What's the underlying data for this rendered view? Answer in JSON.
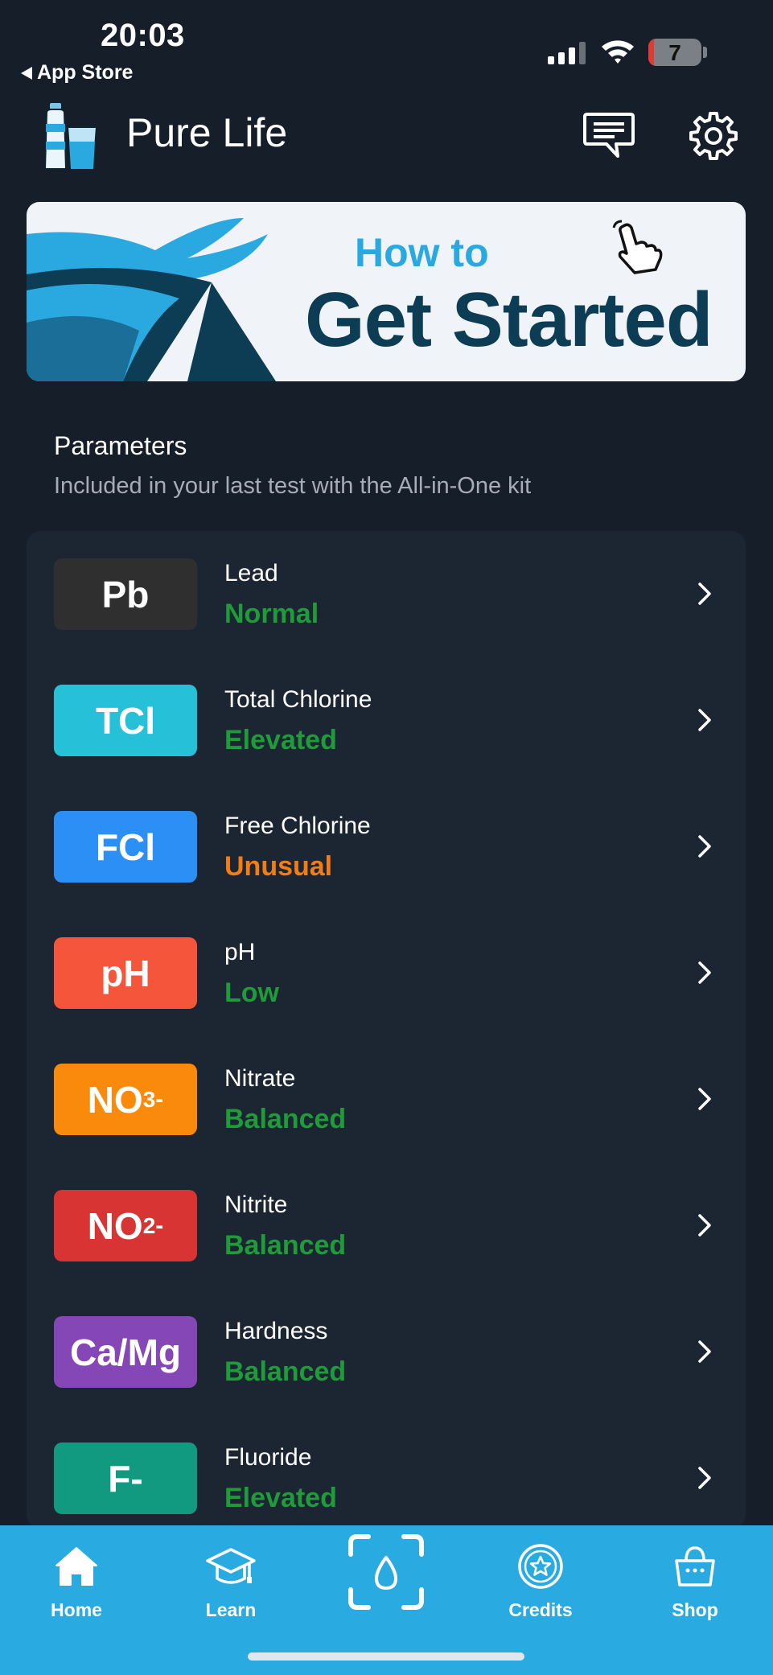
{
  "status_bar": {
    "time": "20:03",
    "back_label": "App Store",
    "battery_level": "7"
  },
  "header": {
    "title": "Pure Life",
    "logo_icon": "water-bottle-glass-icon",
    "chat_icon": "chat-bubble-icon",
    "settings_icon": "gear-icon"
  },
  "banner": {
    "subtitle": "How to",
    "title": "Get Started"
  },
  "parameters": {
    "title": "Parameters",
    "subtitle": "Included in your last test with the All-in-One kit",
    "items": [
      {
        "code": "Pb",
        "name": "Lead",
        "status": "Normal",
        "badge_color": "#2f2f2f",
        "status_color": "#1f9b3a"
      },
      {
        "code": "TCl",
        "name": "Total Chlorine",
        "status": "Elevated",
        "badge_color": "#26c0d8",
        "status_color": "#1f9b3a"
      },
      {
        "code": "FCl",
        "name": "Free Chlorine",
        "status": "Unusual",
        "badge_color": "#2b8ff5",
        "status_color": "#f27d16"
      },
      {
        "code": "pH",
        "name": "pH",
        "status": "Low",
        "badge_color": "#f5553a",
        "status_color": "#1f9b3a"
      },
      {
        "code": "NO",
        "code_sub": "3",
        "code_sup": "-",
        "name": "Nitrate",
        "status": "Balanced",
        "badge_color": "#f98a0c",
        "status_color": "#1f9b3a"
      },
      {
        "code": "NO",
        "code_sub": "2",
        "code_sup": "-",
        "name": "Nitrite",
        "status": "Balanced",
        "badge_color": "#d83433",
        "status_color": "#1f9b3a"
      },
      {
        "code": "Ca/Mg",
        "name": "Hardness",
        "status": "Balanced",
        "badge_color": "#8547b5",
        "status_color": "#1f9b3a"
      },
      {
        "code": "F-",
        "name": "Fluoride",
        "status": "Elevated",
        "badge_color": "#119a80",
        "status_color": "#1f9b3a"
      }
    ]
  },
  "tabbar": {
    "tabs": [
      {
        "label": "Home",
        "icon": "home-icon"
      },
      {
        "label": "Learn",
        "icon": "graduation-cap-icon"
      },
      {
        "label": "",
        "icon": "scan-water-drop-icon"
      },
      {
        "label": "Credits",
        "icon": "star-badge-icon"
      },
      {
        "label": "Shop",
        "icon": "shopping-basket-icon"
      }
    ]
  },
  "colors": {
    "background": "#161e2a",
    "card": "#1c2633",
    "tabbar": "#29abe2",
    "banner_blue": "#2aa9e0",
    "banner_navy": "#0d3c55"
  }
}
